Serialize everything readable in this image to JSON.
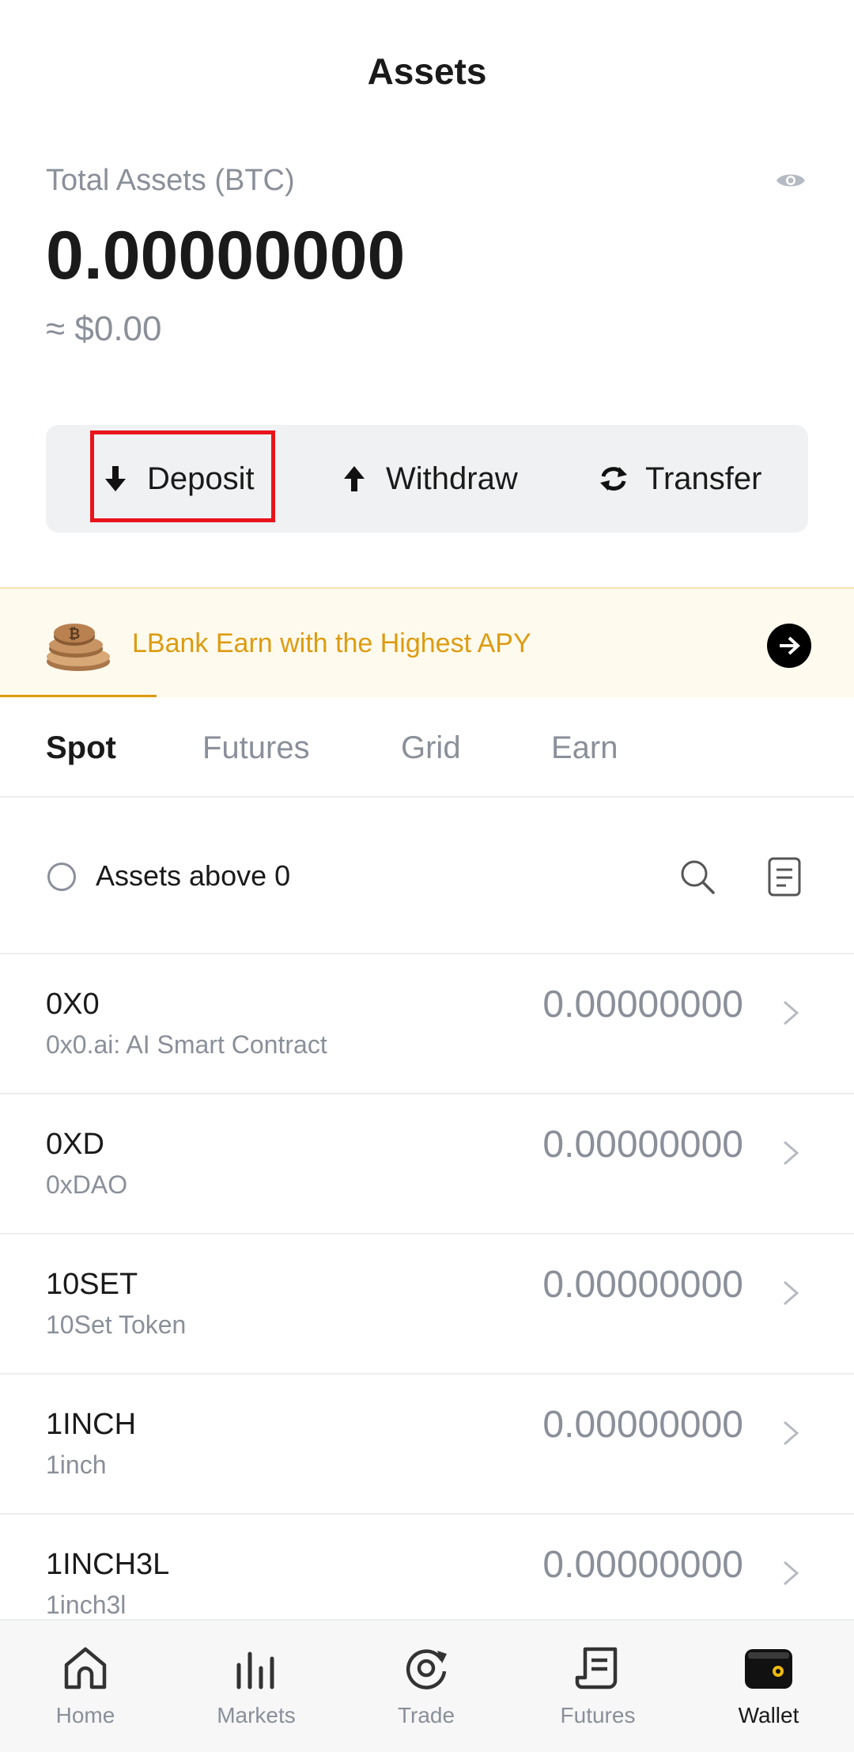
{
  "header": {
    "title": "Assets"
  },
  "total": {
    "label": "Total Assets (BTC)",
    "amount": "0.00000000",
    "fiat": "≈ $0.00"
  },
  "actions": {
    "deposit": "Deposit",
    "withdraw": "Withdraw",
    "transfer": "Transfer"
  },
  "banner": {
    "text": "LBank Earn with the Highest APY"
  },
  "tabs": [
    {
      "label": "Spot",
      "active": true
    },
    {
      "label": "Futures",
      "active": false
    },
    {
      "label": "Grid",
      "active": false
    },
    {
      "label": "Earn",
      "active": false
    }
  ],
  "filter": {
    "label": "Assets above 0",
    "checked": false
  },
  "assets": [
    {
      "symbol": "0X0",
      "name": "0x0.ai: AI Smart Contract",
      "balance": "0.00000000"
    },
    {
      "symbol": "0XD",
      "name": "0xDAO",
      "balance": "0.00000000"
    },
    {
      "symbol": "10SET",
      "name": "10Set Token",
      "balance": "0.00000000"
    },
    {
      "symbol": "1INCH",
      "name": "1inch",
      "balance": "0.00000000"
    },
    {
      "symbol": "1INCH3L",
      "name": "1inch3l",
      "balance": "0.00000000"
    }
  ],
  "nav": [
    {
      "label": "Home",
      "icon": "home-icon",
      "active": false
    },
    {
      "label": "Markets",
      "icon": "markets-icon",
      "active": false
    },
    {
      "label": "Trade",
      "icon": "trade-icon",
      "active": false
    },
    {
      "label": "Futures",
      "icon": "futures-icon",
      "active": false
    },
    {
      "label": "Wallet",
      "icon": "wallet-icon",
      "active": true
    }
  ],
  "colors": {
    "accent": "#dd9b10",
    "highlight": "#e8131b",
    "text_primary": "#1a1a1a",
    "text_secondary": "#8a8f99",
    "banner_bg": "#fffaee",
    "action_bar_bg": "#f0f1f3"
  }
}
